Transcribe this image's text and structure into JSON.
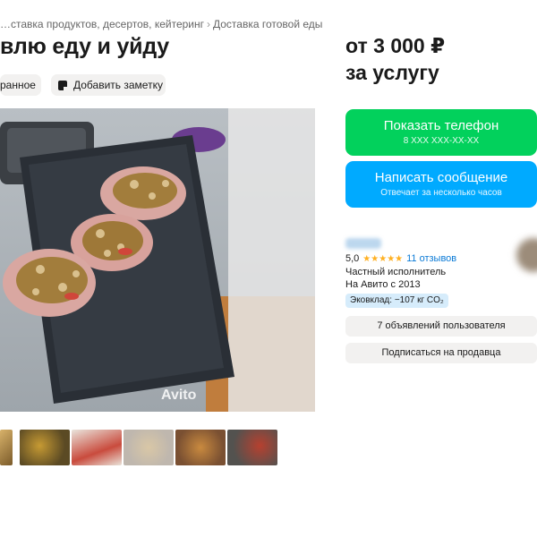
{
  "breadcrumb": {
    "items": [
      "…ставка продуктов, десертов, кейтеринг",
      "Доставка готовой еды"
    ],
    "separator": "›"
  },
  "listing": {
    "title": "влю еду и уйду",
    "favorite_label": "ранное",
    "note_label": "Добавить заметку",
    "watermark": "Avito"
  },
  "price": {
    "line1": "от 3 000 ₽",
    "line2": "за услугу"
  },
  "contact": {
    "phone_label": "Показать телефон",
    "phone_mask": "8 XXX XXX-XX-XX",
    "message_label": "Написать сообщение",
    "message_sub": "Отвечает за несколько часов"
  },
  "seller": {
    "rating": "5,0",
    "stars": "★★★★★",
    "reviews": "11 отзывов",
    "type": "Частный исполнитель",
    "since": "На Авито с 2013",
    "eco": "Эковклад: −107 кг CO₂",
    "ads_label": "7 объявлений пользователя",
    "subscribe_label": "Подписаться на продавца"
  },
  "colors": {
    "phone_button": "#02d15c",
    "message_button": "#00aaff",
    "stars": "#ffb021",
    "link": "#0a7ad6"
  },
  "thumbnail_count": 6
}
